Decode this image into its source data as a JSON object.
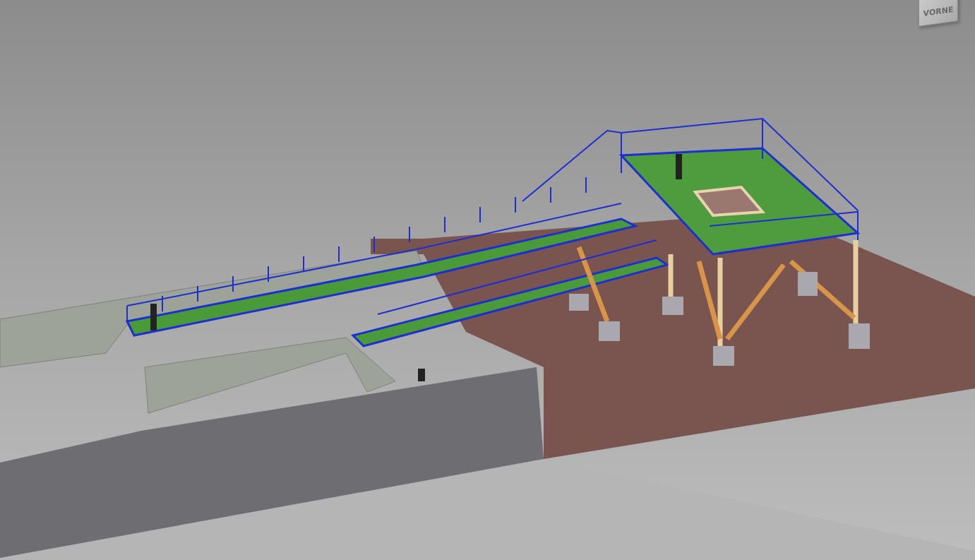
{
  "viewport": {
    "view_cube": {
      "face_label": "VORNE"
    }
  }
}
